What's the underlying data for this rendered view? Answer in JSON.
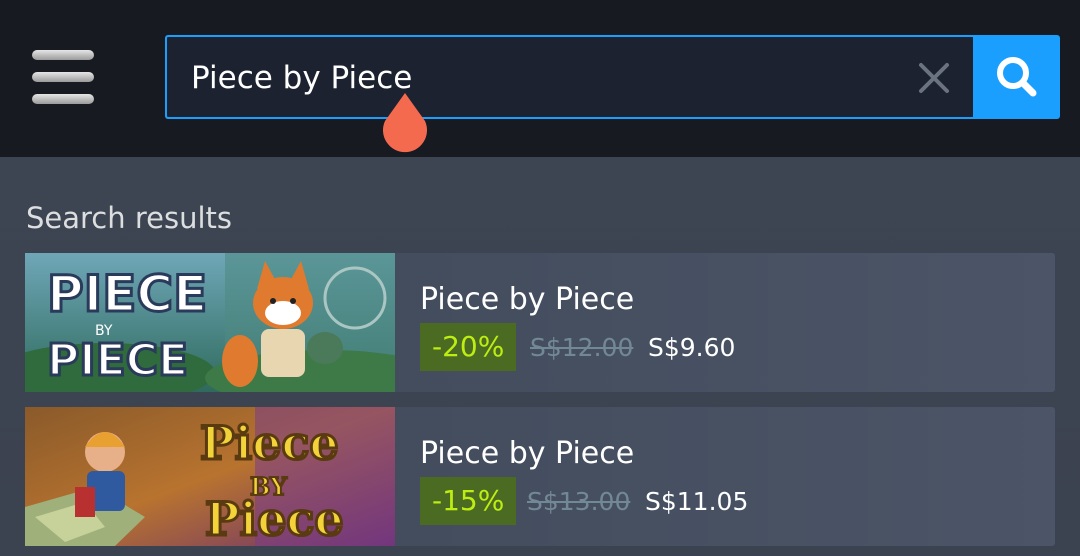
{
  "search": {
    "value": "Piece by Piece",
    "clear_icon": "close-icon",
    "submit_icon": "search-icon"
  },
  "menu": {
    "icon": "hamburger-menu-icon"
  },
  "results": {
    "heading": "Search results",
    "items": [
      {
        "title": "Piece by Piece",
        "discount": "-20%",
        "original_price": "S$12.00",
        "final_price": "S$9.60",
        "thumbnail_logo_text": "PIECE BY PIECE"
      },
      {
        "title": "Piece by Piece",
        "discount": "-15%",
        "original_price": "S$13.00",
        "final_price": "S$11.05",
        "thumbnail_logo_text": "PIECE BY PIECE"
      }
    ]
  },
  "colors": {
    "accent": "#1a9fff",
    "discount_bg": "#4c6b22",
    "discount_text": "#beee11",
    "cursor_handle": "#f46a4e"
  }
}
